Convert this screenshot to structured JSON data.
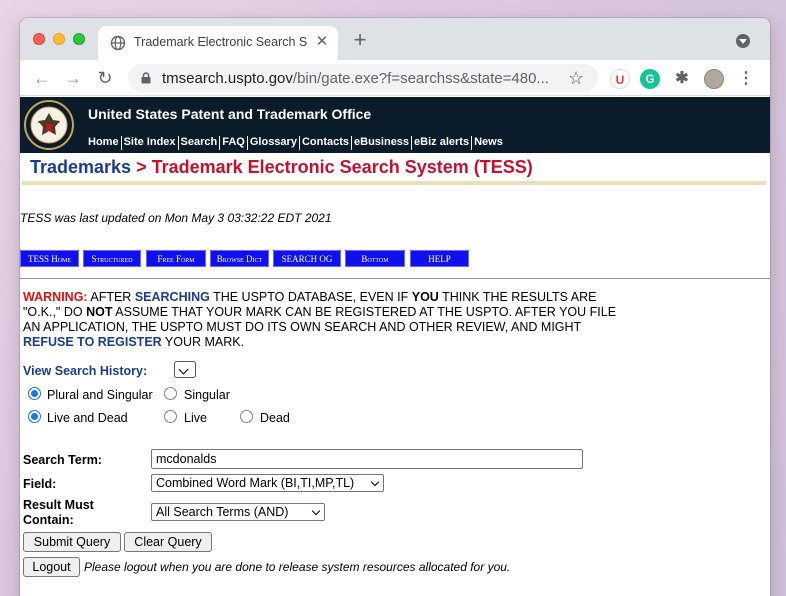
{
  "browser": {
    "tab_title": "Trademark Electronic Search S",
    "tab_close": "✕",
    "new_tab": "+",
    "url_host": "tmsearch.uspto.gov",
    "url_path": "/bin/gate.exe?f=searchss&state=480...",
    "nav_back": "←",
    "nav_forward": "→",
    "nav_reload": "↻",
    "star": "☆",
    "ext_u": "U",
    "ext_g": "G",
    "ext_puzzle": "✱",
    "ext_menu": "⋮"
  },
  "banner": {
    "title": "United States Patent and Trademark Office",
    "nav": [
      "Home",
      "Site Index",
      "Search",
      "FAQ",
      "Glossary",
      "Contacts",
      "eBusiness",
      "eBiz alerts",
      "News"
    ]
  },
  "breadcrumb": {
    "root": "Trademarks",
    "separator": " > ",
    "current": "Trademark Electronic Search System (TESS)"
  },
  "updated_text": "TESS was last updated on Mon May 3 03:32:22 EDT 2021",
  "tess_buttons": [
    "TESS Home",
    "Structured",
    "Free Form",
    "Browse Dict",
    "SEARCH OG",
    "Bottom",
    "HELP"
  ],
  "warning": {
    "w1": "WARNING:",
    "t1": " AFTER ",
    "w2": "SEARCHING",
    "t2": " THE USPTO DATABASE, EVEN IF ",
    "b1": "YOU",
    "t3": " THINK THE RESULTS ARE \"O.K.,\" DO ",
    "b2": "NOT",
    "t4": " ASSUME THAT YOUR MARK CAN BE REGISTERED AT THE USPTO. AFTER YOU FILE AN APPLICATION, THE USPTO MUST DO ITS OWN SEARCH AND OTHER REVIEW, AND MIGHT ",
    "w3": "REFUSE TO REGISTER",
    "t5": " YOUR MARK."
  },
  "form": {
    "history_label": "View Search History:",
    "plural_singular": "Plural and Singular",
    "singular": "Singular",
    "live_and_dead": "Live and Dead",
    "live": "Live",
    "dead": "Dead",
    "search_term_label": "Search Term:",
    "search_term_value": "mcdonalds",
    "field_label": "Field:",
    "field_value": "Combined Word Mark (BI,TI,MP,TL)",
    "result_label_1": "Result Must",
    "result_label_2": "Contain:",
    "result_value": "All Search Terms (AND)",
    "submit": "Submit Query",
    "clear": "Clear Query",
    "logout": "Logout",
    "logout_note": "Please logout when you are done to release system resources allocated for you."
  }
}
